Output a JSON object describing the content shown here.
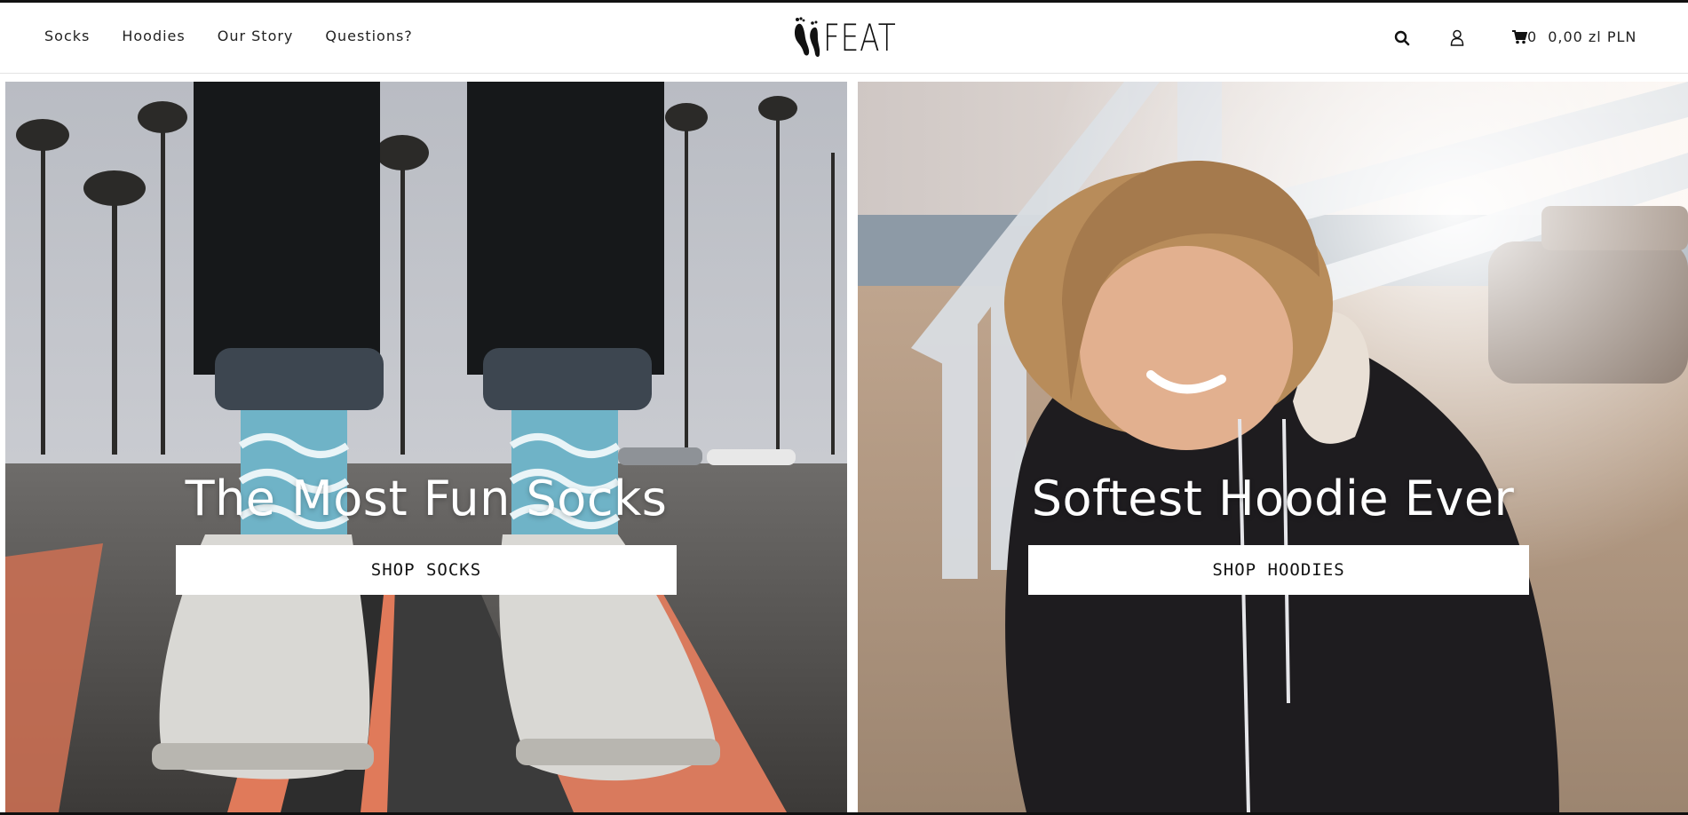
{
  "header": {
    "nav": [
      {
        "label": "Socks"
      },
      {
        "label": "Hoodies"
      },
      {
        "label": "Our Story"
      },
      {
        "label": "Questions?"
      }
    ],
    "logo_text": "FEAT",
    "cart": {
      "count": "0",
      "total": "0,00 zl PLN"
    }
  },
  "icons": {
    "search": "search-icon",
    "account": "user-icon",
    "cart": "cart-icon",
    "logo": "footprints-logo"
  },
  "hero": {
    "left": {
      "title": "The Most Fun Socks",
      "button": "SHOP SOCKS"
    },
    "right": {
      "title": "Softest Hoodie Ever",
      "button": "SHOP HOODIES"
    }
  },
  "colors": {
    "accent": "#111111",
    "button_bg": "#ffffff",
    "header_bg": "#ffffff"
  }
}
